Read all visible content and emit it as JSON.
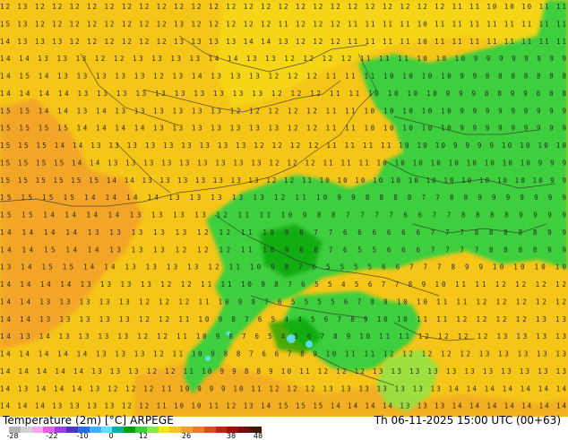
{
  "map": {
    "title": "Temperature (2m) [°C] ARPEGE",
    "datetime": "Th 06-11-2025 15:00 UTC (00+63)",
    "value_rows": [
      "12 13 12 12 12 12 12 12 12 12 12 12 12 12 12 12 12 12 12 12 12 12 12 12 12 12 11 11 10 10 10 11 11",
      "15 13 12 12 12 12 12 12 12 12 13 12 12 12 12 12 11 12 12 12 11 11 11 11 10 11 11 11 11 11 11 11 11",
      "14 13 13 13 12 12 12 12 12 12 13 13 13 13 14 14 13 12 12 12 11 11 11 11 10 11 11 11 11 11 11 11 11",
      "14 14 13 13 13 12 12 13 13 13 13 14 14 13 13 12 12 12 12 11 11 11 10 10 10 9 9 9 9 9 9 9 9",
      "14 15 14 13 13 13 13 13 12 13 14 13 13 13 12 12 12 11 11 11 10 10 10 10 9 9 8 8 8 8 8 8 8",
      "14 14 14 14 13 13 13 13 13 13 13 13 13 13 12 12 12 11 11 10 10 10 10 9 9 9 8 8 9 9 8 8 8",
      "15 15 14 14 13 14 13 13 13 13 13 13 12 12 12 12 12 11 11 10 10 10 10 10 9 9 9 9 9 9 9 9 9",
      "15 15 15 15 14 14 14 14 13 13 13 13 13 13 13 12 12 11 11 10 10 10 10 10 9 9 9 9 9 9 9 9 9",
      "15 15 15 14 14 13 13 13 13 13 13 13 13 13 12 12 12 12 11 11 11 11 10 10 10 9 9 9 9 10 10 10 10",
      "15 15 15 15 14 14 13 13 13 13 13 13 13 13 13 12 12 12 11 11 11 10 10 10 10 10 10 10 10 10 9 9 9",
      "15 15 15 15 15 15 14 14 13 13 13 13 13 13 13 12 12 11 10 10 10 10 10 10 10 10 10 10 10 10 10 9 9",
      "15 15 15 15 14 14 14 14 13 13 13 13 13 12 11 10 9 9 8 8 8 8 7 7 8 8 9 9 9 9 9 9 9",
      "15 15 14 14 14 14 13 13 13 13 12 11 11 10 9 8 8 7 7 7 7 6 6 7 7 8 8 8 8 9 9 9 9",
      "14 14 14 14 13 13 13 13 13 12 12 11 10 9 8 7 7 6 6 6 6 6 6 7 7 7 8 8 8 8 8 9 9",
      "14 14 15 14 14 13 13 13 12 12 12 11 10 9 8 8 7 6 5 5 6 6 6 7 7 7 7 8 8 8 8 9 9",
      "13 14 15 15 14 14 13 13 13 13 12 11 10 9 8 7 6 5 5 5 5 6 6 7 7 7 8 9 9 10 10 10 10",
      "14 14 14 14 13 13 13 13 12 12 11 11 10 9 8 7 6 5 5 4 5 6 7 7 8 9 10 11 11 12 12 12 12",
      "14 14 13 13 13 13 13 12 12 12 11 10 9 8 7 6 5 5 5 5 6 7 8 9 10 10 11 11 12 12 12 12 12",
      "14 14 13 13 13 13 13 12 12 11 10 9 8 7 6 5 4 4 5 6 7 8 9 10 10 11 11 12 12 12 12 13 13",
      "14 13 14 13 13 13 13 12 12 11 10 9 8 7 6 5 4 5 6 7 8 9 10 11 11 12 12 12 12 13 13 13 13",
      "14 14 14 14 14 13 13 13 12 11 10 9 8 8 7 6 6 7 8 9 10 11 11 12 12 12 12 12 13 13 13 13 13",
      "14 14 14 14 14 13 13 13 12 12 11 10 9 9 8 8 9 10 11 12 12 12 13 13 13 13 13 13 13 13 13 13 13",
      "14 13 14 14 14 13 12 12 12 11 10 9 9 9 10 11 12 12 12 13 13 13 13 13 13 13 14 14 14 14 14 14 14",
      "14 14 14 13 13 13 13 12 12 11 10 10 11 12 13 14 15 15 15 14 14 14 14 13 13 13 14 14 14 14 14 14 14"
    ],
    "legend": {
      "tick_labels": [
        "-28",
        "-22",
        "-10",
        "0",
        "12",
        "26",
        "38",
        "48"
      ],
      "colors": [
        "#b4b4b4",
        "#d3d3d3",
        "#f2a8f2",
        "#e060e0",
        "#9f3fe6",
        "#5030d0",
        "#2a6be8",
        "#3fb2ff",
        "#60e0ff",
        "#00b4a0",
        "#00a000",
        "#3ccf3c",
        "#86e84a",
        "#f6e318",
        "#f5c518",
        "#f3a02c",
        "#ec7a2a",
        "#e04a20",
        "#c81f14",
        "#a00d0d",
        "#701010",
        "#3a1a0a"
      ]
    }
  }
}
